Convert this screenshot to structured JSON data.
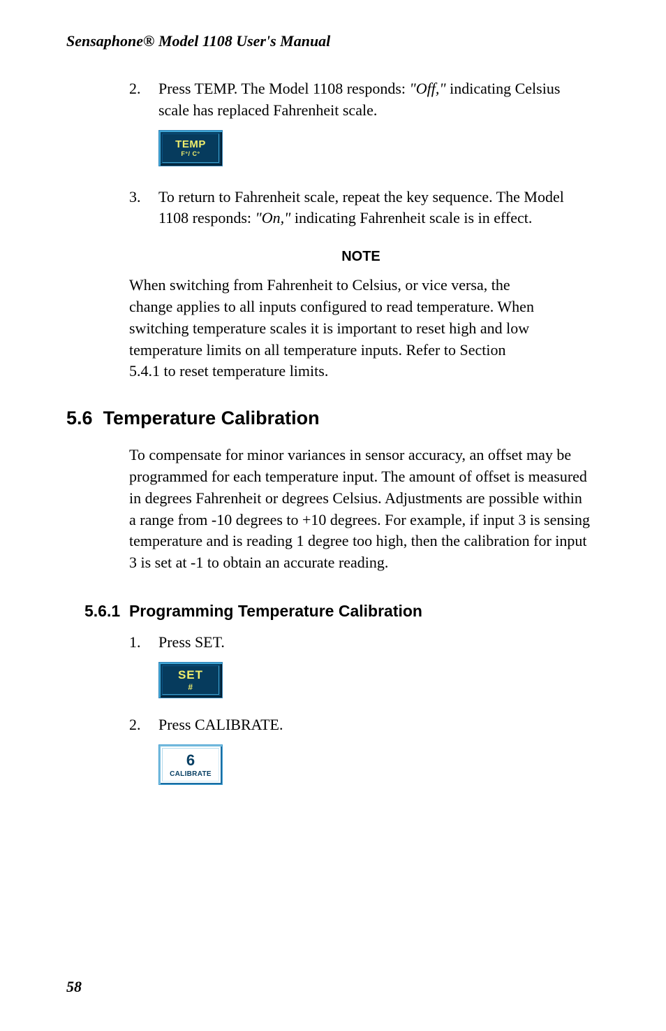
{
  "header": {
    "title": "Sensaphone® Model 1108 User's Manual"
  },
  "steps_a": [
    {
      "num": "2.",
      "pre": "Press TEMP. The Model 1108 responds: ",
      "quote": "\"Off,\"",
      "post": " indicating Celsius scale has replaced Fahrenheit scale."
    }
  ],
  "button_temp": {
    "main": "TEMP",
    "sub": "F°/ C°"
  },
  "steps_b": [
    {
      "num": "3.",
      "pre": "To return to Fahrenheit scale, repeat the key sequence. The Model 1108 responds: ",
      "quote": "\"On,\"",
      "post": " indicating Fahrenheit scale is in effect."
    }
  ],
  "note": {
    "heading": "NOTE",
    "body": "When switching from Fahrenheit to Celsius, or vice versa, the change applies to all inputs configured to read temperature. When switching temperature scales it is important to reset high and low temperature limits on all temperature inputs. Refer to Section 5.4.1 to reset temperature limits."
  },
  "section": {
    "num": "5.6",
    "title": "Temperature Calibration",
    "body": "To compensate for minor variances in sensor accuracy, an offset may be programmed for each temperature input. The amount of offset is measured in degrees Fahrenheit or degrees Celsius. Adjustments are possible within a range from -10 degrees to +10 degrees. For example, if input 3 is sensing temperature and is reading 1 degree too high, then the calibration for input 3 is set at -1 to obtain an accurate reading."
  },
  "subsection": {
    "num": "5.6.1",
    "title": "Programming Temperature Calibration",
    "steps": [
      {
        "num": "1.",
        "text": "Press SET."
      },
      {
        "num": "2.",
        "text": "Press CALIBRATE."
      }
    ]
  },
  "button_set": {
    "main": "SET",
    "sub": "#"
  },
  "button_calibrate": {
    "main": "6",
    "sub": "CALIBRATE"
  },
  "page_number": "58"
}
